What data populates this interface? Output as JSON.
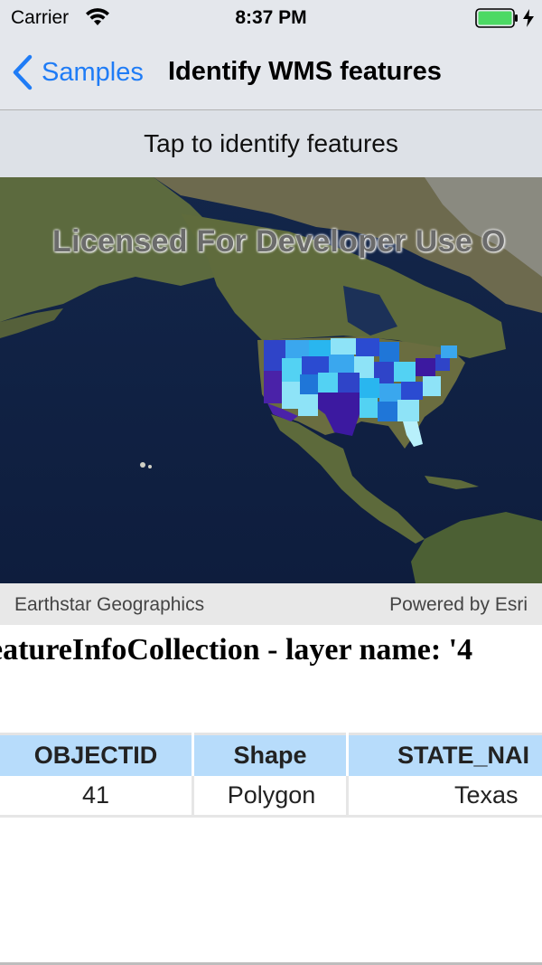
{
  "status_bar": {
    "carrier": "Carrier",
    "time": "8:37 PM",
    "battery_color": "#4cd964"
  },
  "nav": {
    "back_label": "Samples",
    "title": "Identify WMS features",
    "accent_color": "#1f7cf6"
  },
  "instruction": "Tap to identify features",
  "map": {
    "watermark": "Licensed For Developer Use O",
    "attribution_left": "Earthstar Geographics",
    "attribution_right": "Powered by Esri"
  },
  "result": {
    "heading": "eatureInfoCollection - layer name: '4",
    "columns": [
      "OBJECTID",
      "Shape",
      "STATE_NAI"
    ],
    "rows": [
      [
        "41",
        "Polygon",
        "Texas"
      ]
    ]
  },
  "icons": [
    "back-chevron-icon",
    "wifi-icon",
    "battery-icon",
    "charging-bolt-icon"
  ]
}
